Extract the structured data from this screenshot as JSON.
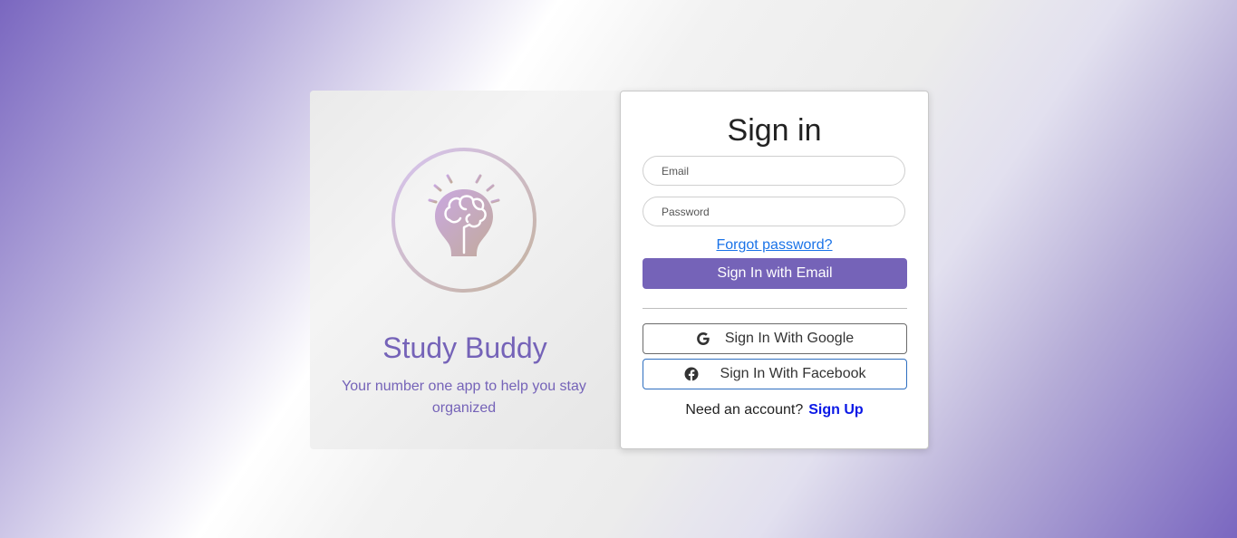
{
  "brand": {
    "name": "Study Buddy",
    "tagline": "Your number one app to help you stay organized"
  },
  "signin": {
    "title": "Sign in",
    "email_placeholder": "Email",
    "password_placeholder": "Password",
    "forgot_label": "Forgot password?",
    "email_button_label": "Sign In with Email",
    "google_button_label": "Sign In With Google",
    "facebook_button_label": "Sign In With Facebook",
    "signup_prompt": "Need an account?",
    "signup_link": "Sign Up"
  },
  "icons": {
    "logo": "lightbulb-brain-icon",
    "google": "google-icon",
    "facebook": "facebook-icon"
  },
  "colors": {
    "accent": "#7563b8",
    "link": "#1a73e8",
    "signup_link": "#0a18e6",
    "facebook_border": "#2f6fc0"
  }
}
